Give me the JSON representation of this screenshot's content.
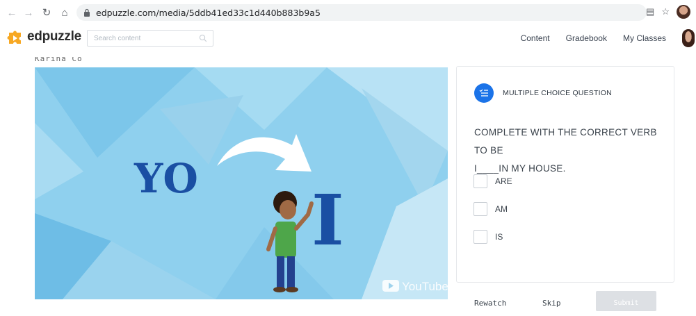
{
  "browser": {
    "url": "edpuzzle.com/media/5ddb41ed33c1d440b883b9a5"
  },
  "header": {
    "logo_text": "edpuzzle",
    "search": {
      "placeholder": "Search content"
    },
    "nav": [
      "Content",
      "Gradebook",
      "My Classes"
    ]
  },
  "owner_name": "Karina Co",
  "video": {
    "big_word_left": "YO",
    "big_word_right": "I",
    "watermark": "YouTube"
  },
  "question": {
    "type_label": "MULTIPLE CHOICE QUESTION",
    "text_line1": "COMPLETE WITH THE CORRECT VERB TO BE",
    "text_line2": "I____IN MY HOUSE.",
    "options": [
      "ARE",
      "AM",
      "IS"
    ]
  },
  "actions": {
    "rewatch": "Rewatch",
    "skip": "Skip",
    "submit": "Submit"
  },
  "colors": {
    "accent": "#1b73e8",
    "big_word": "#1a4fa3",
    "video_bg": "#8fd0ee",
    "submit_bg": "#dde0e4"
  }
}
